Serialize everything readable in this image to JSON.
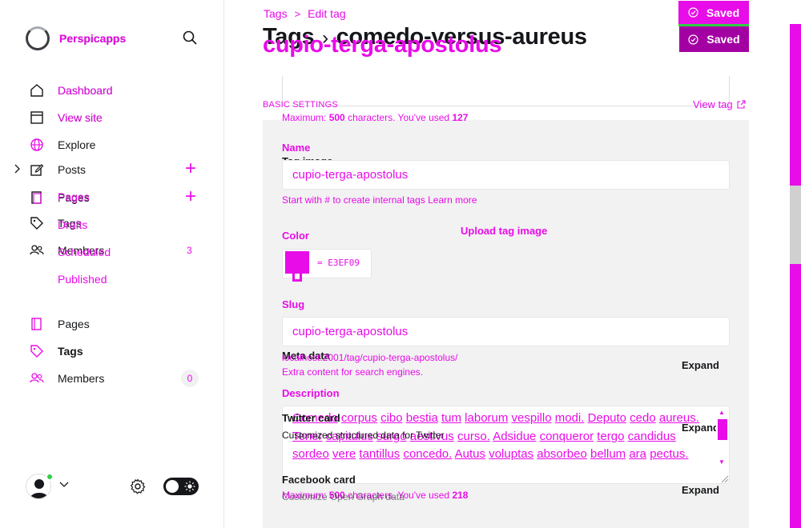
{
  "sidebar": {
    "brand_a": "Perspicapps",
    "brand_b": "Perspicapps",
    "nav": {
      "dashboard": "Dashboard",
      "dashboard_ghost": "Dashboard",
      "view_site": "View site",
      "view_site_ghost": "View site",
      "explore": "Explore",
      "posts": "Posts",
      "pages_a": "Pages",
      "pages_b": "Pages",
      "tags_a": "Tags",
      "drafts": "Drafts",
      "members_a": "Members",
      "scheduled": "Scheduled",
      "members_count": "3",
      "published": "Published",
      "pages": "Pages",
      "tags": "Tags",
      "members": "Members",
      "members_badge": "0"
    }
  },
  "header": {
    "breadcrumb_root": "Tags",
    "breadcrumb_sep": ">",
    "breadcrumb_current": "Edit tag",
    "title_root": "Tags",
    "title_sep": "›",
    "title_slug": "comedo-versus-aureus",
    "title_overlay": "cupio-terga-apostolus",
    "saved_primary": "Saved",
    "saved_secondary": "Saved"
  },
  "form": {
    "section_label": "BASIC SETTINGS",
    "view_tag": "View tag",
    "meta_max_prefix": "Maximum:",
    "meta_max_count": "500",
    "meta_max_mid": "characters. You've used",
    "meta_max_used": "127",
    "name_label": "Name",
    "tag_image_label": "Tag image",
    "name_value": "cupio-terga-apostolus",
    "name_hint": "Start with # to create internal tags Learn more",
    "upload_label": "Upload tag image",
    "color_label": "Color",
    "color_value": "= E3EF09",
    "slug_label": "Slug",
    "slug_value": "cupio-terga-apostolus",
    "meta_data_label": "Meta data",
    "slug_url": "localhost:2001/tag/cupio-terga-apostolus/",
    "meta_data_hint": "Extra content for search engines.",
    "meta_expand": "Expand",
    "description_label": "Description",
    "twitter_label": "Twitter card",
    "twitter_hint": "Customized structured data for Twitter",
    "twitter_expand": "Expand",
    "description_words": [
      "Comedo",
      "corpus",
      "cibo",
      "bestia",
      "tum",
      "laborum",
      "vespillo",
      "modi.",
      "Deputo",
      "cedo",
      "aureus.",
      "Tener",
      "capitulus",
      "surgo",
      "aestivus",
      "curso.",
      "Adsidue",
      "conqueror",
      "tergo",
      "candidus",
      "sordeo",
      "vere",
      "tantillus",
      "concedo.",
      "Autus",
      "voluptas",
      "absorbeo",
      "bellum",
      "ara",
      "pectus."
    ],
    "facebook_label": "Facebook card",
    "desc_max_prefix": "Maximum:",
    "desc_max_count": "500",
    "desc_max_mid": "characters. You've used",
    "desc_max_used": "218",
    "facebook_hint": "Customize Open Graph data",
    "facebook_expand": "Expand"
  },
  "colors": {
    "accent": "#e80ce8",
    "saved_dark": "#a300a3",
    "panel": "#f2f2f2",
    "online": "#30cf43"
  }
}
